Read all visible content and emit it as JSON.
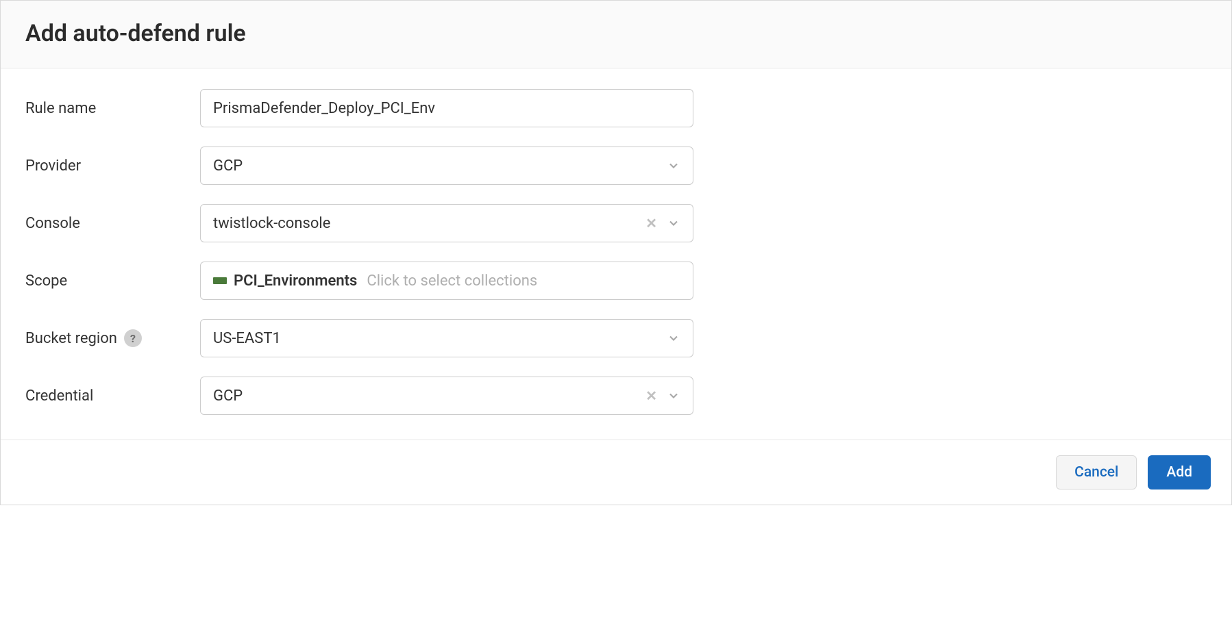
{
  "dialog": {
    "title": "Add auto-defend rule"
  },
  "form": {
    "ruleName": {
      "label": "Rule name",
      "value": "PrismaDefender_Deploy_PCI_Env"
    },
    "provider": {
      "label": "Provider",
      "value": "GCP"
    },
    "console": {
      "label": "Console",
      "value": "twistlock-console"
    },
    "scope": {
      "label": "Scope",
      "tag": "PCI_Environments",
      "placeholder": "Click to select collections"
    },
    "bucketRegion": {
      "label": "Bucket region",
      "value": "US-EAST1"
    },
    "credential": {
      "label": "Credential",
      "value": "GCP"
    }
  },
  "footer": {
    "cancel": "Cancel",
    "add": "Add"
  }
}
